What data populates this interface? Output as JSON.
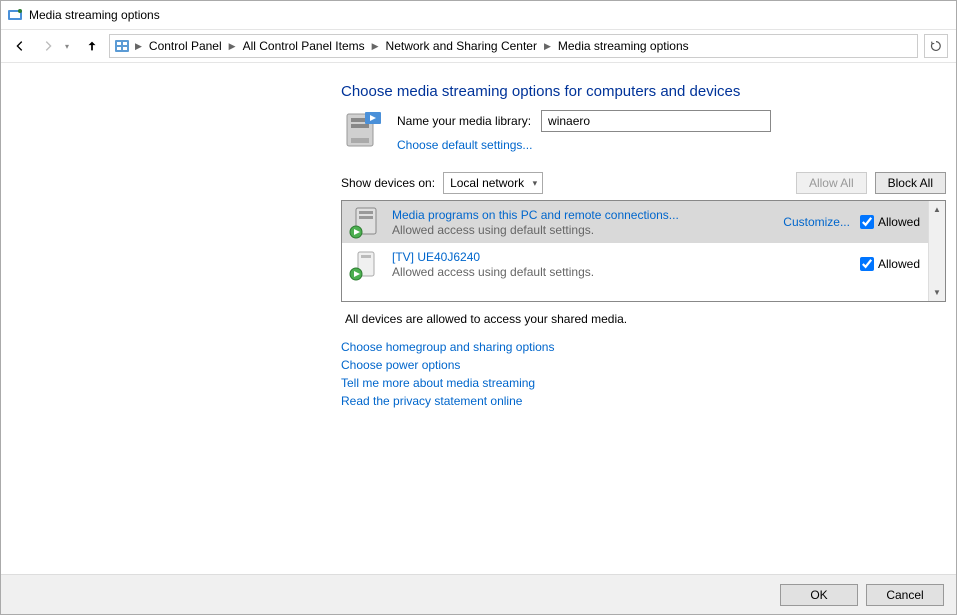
{
  "window": {
    "title": "Media streaming options"
  },
  "breadcrumbs": {
    "items": [
      "Control Panel",
      "All Control Panel Items",
      "Network and Sharing Center",
      "Media streaming options"
    ]
  },
  "heading": "Choose media streaming options for computers and devices",
  "library": {
    "label": "Name your media library:",
    "value": "winaero",
    "default_link": "Choose default settings..."
  },
  "filter": {
    "label": "Show devices on:",
    "selected": "Local network",
    "allow_all": "Allow All",
    "block_all": "Block All"
  },
  "devices": [
    {
      "name": "Media programs on this PC and remote connections...",
      "status": "Allowed access using default settings.",
      "customize": "Customize...",
      "allowed_label": "Allowed",
      "allowed": true,
      "selected": true,
      "show_customize": true
    },
    {
      "name": "[TV] UE40J6240",
      "status": "Allowed access using default settings.",
      "customize": "",
      "allowed_label": "Allowed",
      "allowed": true,
      "selected": false,
      "show_customize": false
    }
  ],
  "status_text": "All devices are allowed to access your shared media.",
  "links": {
    "homegroup": "Choose homegroup and sharing options",
    "power": "Choose power options",
    "tellmore": "Tell me more about media streaming",
    "privacy": "Read the privacy statement online"
  },
  "footer": {
    "ok": "OK",
    "cancel": "Cancel"
  }
}
